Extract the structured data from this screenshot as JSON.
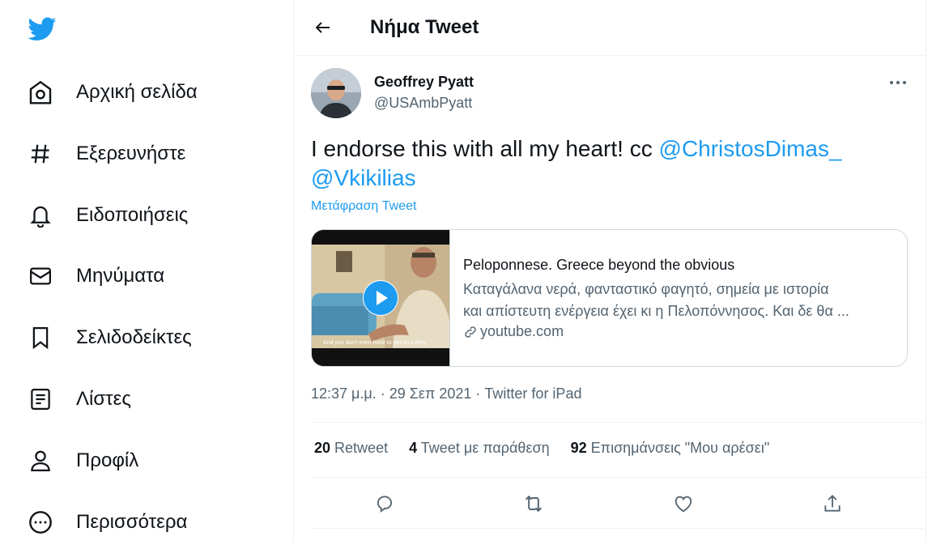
{
  "sidebar": {
    "logo": "twitter-bird-icon",
    "items": [
      {
        "label": "Αρχική σελίδα",
        "icon": "home-icon"
      },
      {
        "label": "Εξερευνήστε",
        "icon": "hashtag-icon"
      },
      {
        "label": "Ειδοποιήσεις",
        "icon": "bell-icon"
      },
      {
        "label": "Μηνύματα",
        "icon": "mail-icon"
      },
      {
        "label": "Σελιδοδείκτες",
        "icon": "bookmark-icon"
      },
      {
        "label": "Λίστες",
        "icon": "list-icon"
      },
      {
        "label": "Προφίλ",
        "icon": "profile-icon"
      },
      {
        "label": "Περισσότερα",
        "icon": "more-circle-icon"
      }
    ]
  },
  "header": {
    "title": "Νήμα Tweet"
  },
  "tweet": {
    "author_name": "Geoffrey Pyatt",
    "author_handle": "@USAmbPyatt",
    "text_prefix": "I endorse this with all my heart!  cc ",
    "mention1": "@ChristosDimas_",
    "mention2": "@Vkikilias",
    "translate": "Μετάφραση Tweet",
    "card": {
      "title": "Peloponnese. Greece beyond the obvious",
      "desc_line1": "Καταγάλανα νερά, φανταστικό φαγητό, σημεία με ιστορία",
      "desc_line2": "και απίστευτη ενέργεια έχει κι η Πελοπόννησος. Και δε θα ...",
      "link": "youtube.com",
      "caption": "And you don't even have to get on a ferry"
    },
    "meta": "12:37 μ.μ. · 29 Σεπ 2021 · Twitter for iPad",
    "stats": {
      "retweets_count": "20",
      "retweets_label": "Retweet",
      "quotes_count": "4",
      "quotes_label": "Tweet με παράθεση",
      "likes_count": "92",
      "likes_label": "Επισημάνσεις \"Μου αρέσει\""
    }
  },
  "colors": {
    "accent": "#1d9bf0",
    "text": "#0f1419",
    "secondary": "#536471",
    "border": "#cfd9de"
  }
}
